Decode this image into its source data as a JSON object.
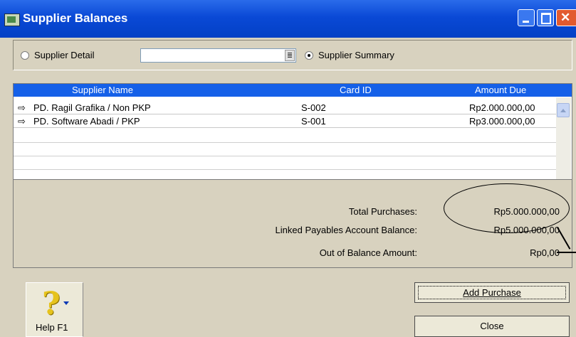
{
  "window": {
    "title": "Supplier Balances"
  },
  "filter": {
    "option_detail": "Supplier Detail",
    "option_summary": "Supplier Summary",
    "supplier_combo_value": ""
  },
  "table": {
    "columns": [
      "Supplier Name",
      "Card ID",
      "Amount Due"
    ],
    "rows": [
      {
        "name": "PD. Ragil Grafika / Non PKP",
        "card_id": "S-002",
        "amount": "Rp2.000.000,00"
      },
      {
        "name": "PD. Software Abadi / PKP",
        "card_id": "S-001",
        "amount": "Rp3.000.000,00"
      }
    ]
  },
  "totals": {
    "total_purchases_label": "Total Purchases:",
    "total_purchases_value": "Rp5.000.000,00",
    "linked_label": "Linked Payables Account Balance:",
    "linked_value": "Rp5.000.000,00",
    "out_of_balance_label": "Out of Balance Amount:",
    "out_of_balance_value": "Rp0,00"
  },
  "buttons": {
    "help": "Help F1",
    "add_purchase": "Add Purchase",
    "close": "Close"
  },
  "colors": {
    "titlebar": "#0a49d6",
    "header": "#1560e8",
    "dialog_bg": "#d8d2bf"
  }
}
